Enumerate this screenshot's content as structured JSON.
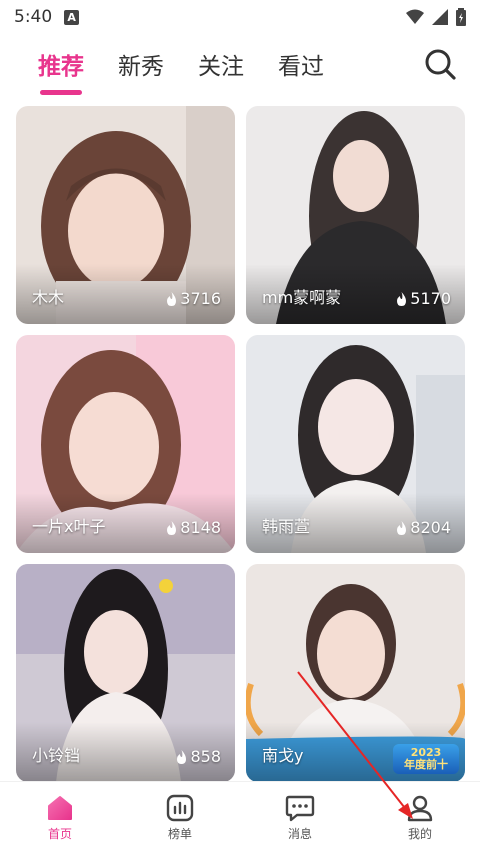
{
  "status_bar": {
    "time": "5:40",
    "badge": "A"
  },
  "top_tabs": [
    {
      "label": "推荐",
      "active": true
    },
    {
      "label": "新秀",
      "active": false
    },
    {
      "label": "关注",
      "active": false
    },
    {
      "label": "看过",
      "active": false
    }
  ],
  "cards": [
    {
      "name": "木木",
      "heat": "3716"
    },
    {
      "name": "mm蒙啊蒙",
      "heat": "5170"
    },
    {
      "name": "一片x叶子",
      "heat": "8148"
    },
    {
      "name": "韩雨萱",
      "heat": "8204"
    },
    {
      "name": "小铃铛",
      "heat": "858"
    },
    {
      "name": "南戈y",
      "badge_year": "2023",
      "badge_text": "年度前十"
    }
  ],
  "bottom_nav": [
    {
      "label": "首页",
      "icon": "home-icon",
      "active": true
    },
    {
      "label": "榜单",
      "icon": "chart-icon",
      "active": false
    },
    {
      "label": "消息",
      "icon": "message-icon",
      "active": false
    },
    {
      "label": "我的",
      "icon": "profile-icon",
      "active": false
    }
  ],
  "colors": {
    "accent": "#e8358d"
  }
}
